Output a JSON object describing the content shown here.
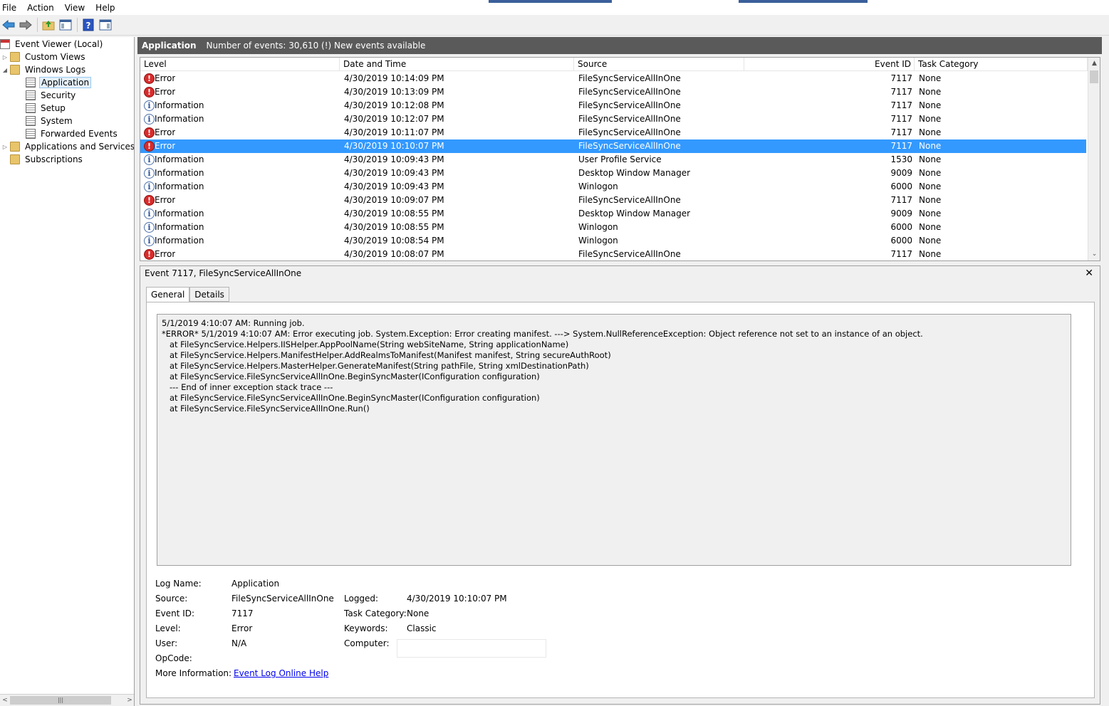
{
  "menu": [
    "File",
    "Action",
    "View",
    "Help"
  ],
  "toolbar": {
    "icons": [
      "back-arrow-icon",
      "forward-arrow-icon",
      "up-folder-icon",
      "show-hide-console-tree-icon",
      "help-icon",
      "action-pane-icon"
    ]
  },
  "tree": {
    "root": "Event Viewer (Local)",
    "custom_views": "Custom Views",
    "windows_logs": "Windows Logs",
    "logs": [
      "Application",
      "Security",
      "Setup",
      "System",
      "Forwarded Events"
    ],
    "apps_services": "Applications and Services Lo",
    "subscriptions": "Subscriptions"
  },
  "header": {
    "title": "Application",
    "info": "Number of events: 30,610 (!) New events available"
  },
  "grid": {
    "columns": [
      "Level",
      "Date and Time",
      "Source",
      "Event ID",
      "Task Category"
    ],
    "rows": [
      {
        "level": "Error",
        "date": "4/30/2019 10:14:09 PM",
        "source": "FileSyncServiceAllInOne",
        "id": "7117",
        "task": "None"
      },
      {
        "level": "Error",
        "date": "4/30/2019 10:13:09 PM",
        "source": "FileSyncServiceAllInOne",
        "id": "7117",
        "task": "None"
      },
      {
        "level": "Information",
        "date": "4/30/2019 10:12:08 PM",
        "source": "FileSyncServiceAllInOne",
        "id": "7117",
        "task": "None"
      },
      {
        "level": "Information",
        "date": "4/30/2019 10:12:07 PM",
        "source": "FileSyncServiceAllInOne",
        "id": "7117",
        "task": "None"
      },
      {
        "level": "Error",
        "date": "4/30/2019 10:11:07 PM",
        "source": "FileSyncServiceAllInOne",
        "id": "7117",
        "task": "None"
      },
      {
        "level": "Error",
        "date": "4/30/2019 10:10:07 PM",
        "source": "FileSyncServiceAllInOne",
        "id": "7117",
        "task": "None"
      },
      {
        "level": "Information",
        "date": "4/30/2019 10:09:43 PM",
        "source": "User Profile Service",
        "id": "1530",
        "task": "None"
      },
      {
        "level": "Information",
        "date": "4/30/2019 10:09:43 PM",
        "source": "Desktop Window Manager",
        "id": "9009",
        "task": "None"
      },
      {
        "level": "Information",
        "date": "4/30/2019 10:09:43 PM",
        "source": "Winlogon",
        "id": "6000",
        "task": "None"
      },
      {
        "level": "Error",
        "date": "4/30/2019 10:09:07 PM",
        "source": "FileSyncServiceAllInOne",
        "id": "7117",
        "task": "None"
      },
      {
        "level": "Information",
        "date": "4/30/2019 10:08:55 PM",
        "source": "Desktop Window Manager",
        "id": "9009",
        "task": "None"
      },
      {
        "level": "Information",
        "date": "4/30/2019 10:08:55 PM",
        "source": "Winlogon",
        "id": "6000",
        "task": "None"
      },
      {
        "level": "Information",
        "date": "4/30/2019 10:08:54 PM",
        "source": "Winlogon",
        "id": "6000",
        "task": "None"
      },
      {
        "level": "Error",
        "date": "4/30/2019 10:08:07 PM",
        "source": "FileSyncServiceAllInOne",
        "id": "7117",
        "task": "None"
      }
    ],
    "selected_index": 5
  },
  "detail": {
    "title": "Event 7117, FileSyncServiceAllInOne",
    "tabs": [
      "General",
      "Details"
    ],
    "message": "5/1/2019 4:10:07 AM: Running job.\n*ERROR* 5/1/2019 4:10:07 AM: Error executing job. System.Exception: Error creating manifest. ---> System.NullReferenceException: Object reference not set to an instance of an object.\n   at FileSyncService.Helpers.IISHelper.AppPoolName(String webSiteName, String applicationName)\n   at FileSyncService.Helpers.ManifestHelper.AddRealmsToManifest(Manifest manifest, String secureAuthRoot)\n   at FileSyncService.Helpers.MasterHelper.GenerateManifest(String pathFile, String xmlDestinationPath)\n   at FileSyncService.FileSyncServiceAllInOne.BeginSyncMaster(IConfiguration configuration)\n   --- End of inner exception stack trace ---\n   at FileSyncService.FileSyncServiceAllInOne.BeginSyncMaster(IConfiguration configuration)\n   at FileSyncService.FileSyncServiceAllInOne.Run()",
    "props": {
      "log_name_label": "Log Name:",
      "log_name": "Application",
      "source_label": "Source:",
      "source": "FileSyncServiceAllInOne",
      "logged_label": "Logged:",
      "logged": "4/30/2019 10:10:07 PM",
      "event_id_label": "Event ID:",
      "event_id": "7117",
      "task_label": "Task Category:",
      "task": "None",
      "level_label": "Level:",
      "level": "Error",
      "keywords_label": "Keywords:",
      "keywords": "Classic",
      "user_label": "User:",
      "user": "N/A",
      "computer_label": "Computer:",
      "opcode_label": "OpCode:",
      "more_info_label": "More Information:",
      "more_info_link": "Event Log Online Help"
    }
  }
}
